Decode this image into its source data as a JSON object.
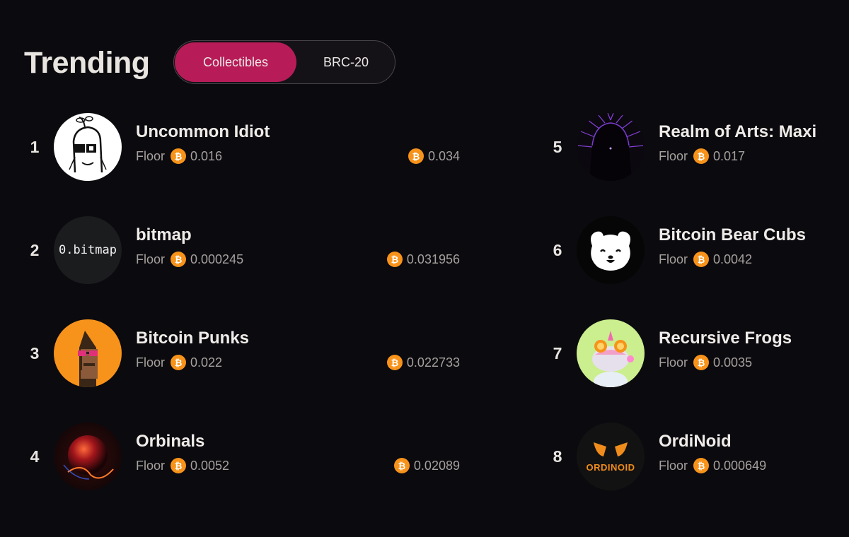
{
  "header": {
    "title": "Trending"
  },
  "tabs": [
    {
      "label": "Collectibles",
      "active": true
    },
    {
      "label": "BRC-20",
      "active": false
    }
  ],
  "floor_label": "Floor",
  "btc_symbol": "₿",
  "avatar_texts": {
    "bitmap": "0.bitmap",
    "ordinoid": "ORDINOID"
  },
  "collections": [
    {
      "rank": "1",
      "name": "Uncommon Idiot",
      "floor": "0.016",
      "volume": "0.034"
    },
    {
      "rank": "2",
      "name": "bitmap",
      "floor": "0.000245",
      "volume": "0.031956"
    },
    {
      "rank": "3",
      "name": "Bitcoin Punks",
      "floor": "0.022",
      "volume": "0.022733"
    },
    {
      "rank": "4",
      "name": "Orbinals",
      "floor": "0.0052",
      "volume": "0.02089"
    },
    {
      "rank": "5",
      "name": "Realm of Arts: Maxi",
      "floor": "0.017"
    },
    {
      "rank": "6",
      "name": "Bitcoin Bear Cubs",
      "floor": "0.0042"
    },
    {
      "rank": "7",
      "name": "Recursive Frogs",
      "floor": "0.0035"
    },
    {
      "rank": "8",
      "name": "OrdiNoid",
      "floor": "0.000649"
    }
  ],
  "colors": {
    "accent": "#b71c58",
    "background": "#0b0a0e",
    "btc": "#f7931a"
  }
}
